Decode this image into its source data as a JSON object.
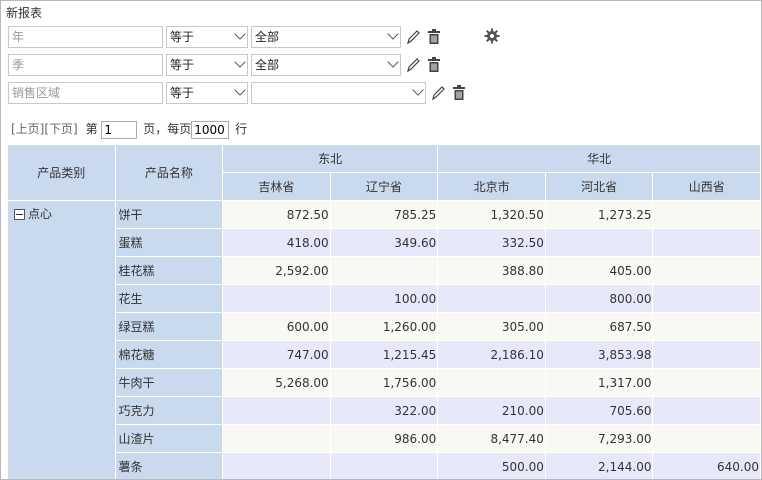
{
  "report": {
    "title": "新报表"
  },
  "filters": [
    {
      "name": "年",
      "operator": "等于",
      "value": "全部"
    },
    {
      "name": "季",
      "operator": "等于",
      "value": "全部"
    },
    {
      "name": "销售区域",
      "operator": "等于",
      "value": ""
    }
  ],
  "pager": {
    "prev": "[上页]",
    "next": "[下页]",
    "page_prefix": "第",
    "page_value": "1",
    "page_suffix": "页，每页",
    "size_value": "1000",
    "size_suffix": "行"
  },
  "table": {
    "col_category": "产品类别",
    "col_product": "产品名称",
    "regions": [
      {
        "name": "东北",
        "provinces": [
          "吉林省",
          "辽宁省"
        ]
      },
      {
        "name": "华北",
        "provinces": [
          "北京市",
          "河北省",
          "山西省"
        ]
      }
    ],
    "category": "点心",
    "rows": [
      {
        "name": "饼干",
        "values": [
          "872.50",
          "785.25",
          "1,320.50",
          "1,273.25",
          ""
        ]
      },
      {
        "name": "蛋糕",
        "values": [
          "418.00",
          "349.60",
          "332.50",
          "",
          ""
        ]
      },
      {
        "name": "桂花糕",
        "values": [
          "2,592.00",
          "",
          "388.80",
          "405.00",
          ""
        ]
      },
      {
        "name": "花生",
        "values": [
          "",
          "100.00",
          "",
          "800.00",
          ""
        ]
      },
      {
        "name": "绿豆糕",
        "values": [
          "600.00",
          "1,260.00",
          "305.00",
          "687.50",
          ""
        ]
      },
      {
        "name": "棉花糖",
        "values": [
          "747.00",
          "1,215.45",
          "2,186.10",
          "3,853.98",
          ""
        ]
      },
      {
        "name": "牛肉干",
        "values": [
          "5,268.00",
          "1,756.00",
          "",
          "1,317.00",
          ""
        ]
      },
      {
        "name": "巧克力",
        "values": [
          "",
          "322.00",
          "210.00",
          "705.60",
          ""
        ]
      },
      {
        "name": "山渣片",
        "values": [
          "",
          "986.00",
          "8,477.40",
          "7,293.00",
          ""
        ]
      },
      {
        "name": "薯条",
        "values": [
          "",
          "",
          "500.00",
          "2,144.00",
          "640.00"
        ]
      }
    ]
  }
}
